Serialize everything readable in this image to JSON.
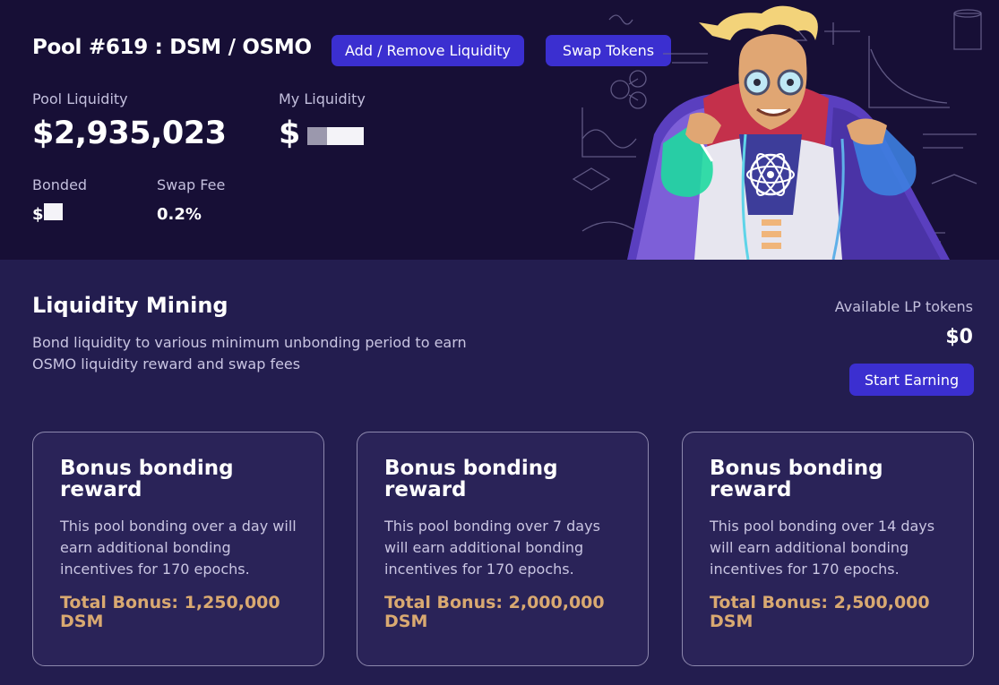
{
  "header": {
    "pool_title": "Pool #619 : DSM / OSMO",
    "add_remove_label": "Add / Remove Liquidity",
    "swap_label": "Swap Tokens",
    "pool_liquidity_label": "Pool Liquidity",
    "pool_liquidity_value": "$2,935,023",
    "my_liquidity_label": "My Liquidity",
    "my_liquidity_value": "$",
    "bonded_label": "Bonded",
    "bonded_value": "$",
    "swap_fee_label": "Swap Fee",
    "swap_fee_value": "0.2%"
  },
  "mining": {
    "title": "Liquidity Mining",
    "description": "Bond liquidity to various minimum unbonding period to earn OSMO liquidity reward and swap fees",
    "lp_label": "Available LP tokens",
    "lp_value": "$0",
    "start_label": "Start Earning"
  },
  "cards": [
    {
      "title": "Bonus bonding reward",
      "text": "This pool bonding over a day will earn additional bonding incentives for 170 epochs.",
      "bonus": "Total Bonus: 1,250,000 DSM"
    },
    {
      "title": "Bonus bonding reward",
      "text": "This pool bonding over 7 days will earn additional bonding incentives for 170 epochs.",
      "bonus": "Total Bonus: 2,000,000 DSM"
    },
    {
      "title": "Bonus bonding reward",
      "text": "This pool bonding over 14 days will earn additional bonding incentives for 170 epochs.",
      "bonus": "Total Bonus: 2,500,000 DSM"
    }
  ],
  "colors": {
    "header_bg": "#170f36",
    "page_bg": "#231d4f",
    "button": "#3b2fd0",
    "bonus_text": "#d9a971"
  },
  "icons": {
    "illustration": "scientist-mascot-illustration"
  }
}
